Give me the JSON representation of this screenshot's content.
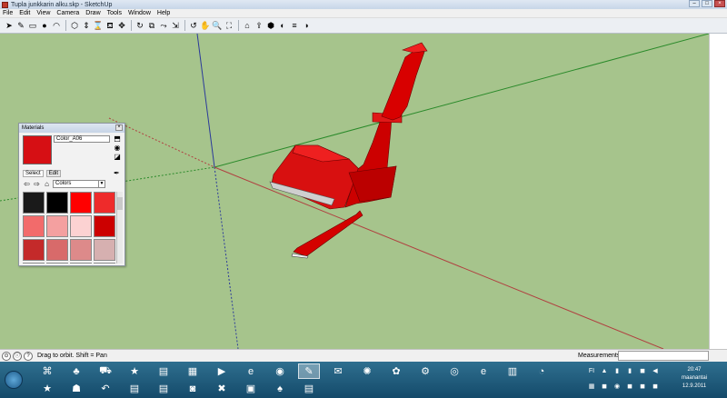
{
  "window": {
    "title": "Tupla junkkarin alku.skp - SketchUp",
    "controls": [
      "–",
      "□",
      "×"
    ]
  },
  "menu": [
    "File",
    "Edit",
    "View",
    "Camera",
    "Draw",
    "Tools",
    "Window",
    "Help"
  ],
  "toolbar": {
    "groups": [
      [
        "select-icon",
        "eraser-icon",
        "rectangle-icon",
        "circle-icon",
        "arc-icon"
      ],
      [
        "polygon-icon",
        "push-pull-icon",
        "tape-measure-icon",
        "paint-bucket-icon",
        "move-icon"
      ],
      [
        "rotate-icon",
        "offset-icon",
        "follow-me-icon",
        "scale-icon"
      ],
      [
        "orbit-icon",
        "pan-icon",
        "zoom-icon",
        "zoom-extents-icon"
      ],
      [
        "warehouse-icon",
        "share-icon",
        "components-icon",
        "styles-icon",
        "layers-icon",
        "shadows-icon"
      ]
    ],
    "glyphs": {
      "select-icon": "➤",
      "eraser-icon": "✎",
      "rectangle-icon": "▭",
      "circle-icon": "●",
      "arc-icon": "◠",
      "polygon-icon": "⬡",
      "push-pull-icon": "⇕",
      "tape-measure-icon": "⌛",
      "paint-bucket-icon": "⛾",
      "move-icon": "✥",
      "rotate-icon": "↻",
      "offset-icon": "⧉",
      "follow-me-icon": "⤳",
      "scale-icon": "⇲",
      "orbit-icon": "↺",
      "pan-icon": "✋",
      "zoom-icon": "🔍",
      "zoom-extents-icon": "⛶",
      "warehouse-icon": "⌂",
      "share-icon": "⇪",
      "components-icon": "⬢",
      "styles-icon": "◐",
      "layers-icon": "≡",
      "shadows-icon": "◑"
    }
  },
  "materials": {
    "title": "Materials",
    "close": "×",
    "current_name": "Color_A06",
    "current_color": "#d60f14",
    "tabs": [
      "Select",
      "Edit"
    ],
    "library": "Colors",
    "swatches": [
      "#1a1a1a",
      "#000000",
      "#ff0000",
      "#ee2b2b",
      "#f26b6b",
      "#f4a0a0",
      "#fcd2d2",
      "#cc0000",
      "#c42a2a",
      "#d86a6a",
      "#dd8a8a",
      "#d6b0b0",
      "#b01818",
      "#c0392b",
      "#cf6a6a",
      "#e1b7b7"
    ]
  },
  "status": {
    "hint": "Drag to orbit.  Shift = Pan",
    "measurements_label": "Measurements"
  },
  "taskbar": {
    "apps": [
      {
        "icon": "sketchup-icon",
        "glyph": "⌘",
        "active": false
      },
      {
        "icon": "game-icon",
        "glyph": "♣",
        "active": false
      },
      {
        "icon": "car-icon",
        "glyph": "⛟",
        "active": false
      },
      {
        "icon": "star-icon",
        "glyph": "★",
        "active": false
      },
      {
        "icon": "document-icon",
        "glyph": "▤",
        "active": false
      },
      {
        "icon": "folder-icon",
        "glyph": "▦",
        "active": false
      },
      {
        "icon": "media-player-icon",
        "glyph": "▶",
        "active": false
      },
      {
        "icon": "ie-icon",
        "glyph": "e",
        "active": false
      },
      {
        "icon": "chrome-icon",
        "glyph": "◉",
        "active": false
      },
      {
        "icon": "sketchup-active-icon",
        "glyph": "✎",
        "active": true
      },
      {
        "icon": "mail-icon",
        "glyph": "✉",
        "active": false
      },
      {
        "icon": "blender-icon",
        "glyph": "✺",
        "active": false
      },
      {
        "icon": "paint-icon",
        "glyph": "✿",
        "active": false
      },
      {
        "icon": "tractor-icon",
        "glyph": "⚙",
        "active": false
      },
      {
        "icon": "steam-icon",
        "glyph": "◎",
        "active": false
      },
      {
        "icon": "ie2-icon",
        "glyph": "e",
        "active": false
      },
      {
        "icon": "winrar-icon",
        "glyph": "▥",
        "active": false
      },
      {
        "icon": "media2-icon",
        "glyph": "◔",
        "active": false
      },
      {
        "icon": "sketchup-star-icon",
        "glyph": "★",
        "active": false
      },
      {
        "icon": "profile-icon",
        "glyph": "☗",
        "active": false
      },
      {
        "icon": "link-icon",
        "glyph": "↶",
        "active": false
      },
      {
        "icon": "notepad-icon",
        "glyph": "▤",
        "active": false
      },
      {
        "icon": "document2-icon",
        "glyph": "▤",
        "active": false
      },
      {
        "icon": "camera-icon",
        "glyph": "◙",
        "active": false
      },
      {
        "icon": "tools-icon",
        "glyph": "✖",
        "active": false
      },
      {
        "icon": "box-icon",
        "glyph": "▣",
        "active": false
      },
      {
        "icon": "pdf-icon",
        "glyph": "♠",
        "active": false
      },
      {
        "icon": "notes-icon",
        "glyph": "▤",
        "active": false
      }
    ],
    "tray_label": "FI",
    "tray_icons": [
      "▲",
      "▮",
      "▮",
      "◼",
      "◀",
      "▦",
      "◼",
      "◉",
      "◼",
      "◼",
      "◼",
      "◼"
    ],
    "time": "20:47",
    "day": "maanantai",
    "date": "12.9.2011"
  }
}
